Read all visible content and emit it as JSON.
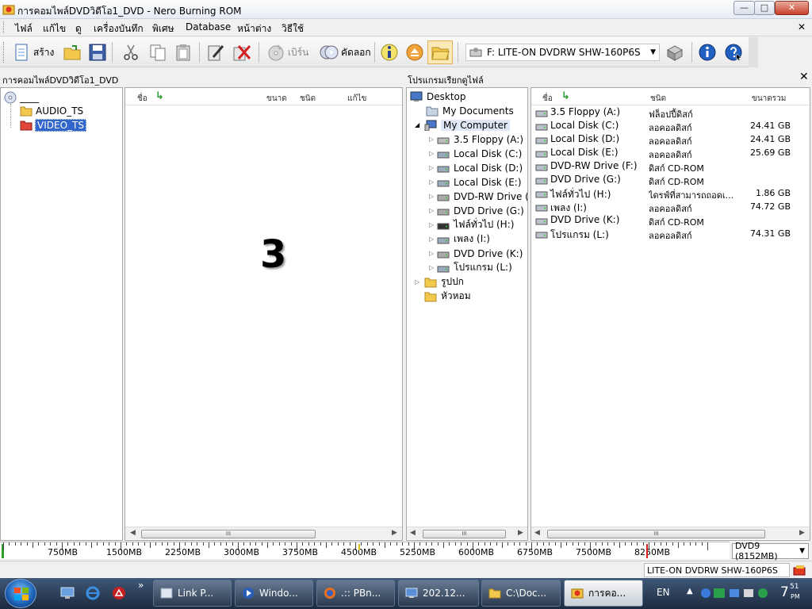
{
  "window": {
    "title": "การคอมไพล์DVDวิดีโอ1_DVD - Nero Burning ROM",
    "min_glyph": "—",
    "max_glyph": "□",
    "close_glyph": "✕"
  },
  "menu": {
    "items": [
      "ไฟล์",
      "แก้ไข",
      "ดู",
      "เครื่องบันทึก",
      "พิเศษ",
      "Database",
      "หน้าต่าง",
      "วิธีใช้"
    ],
    "close_glyph": "✕"
  },
  "toolbar": {
    "new_label": "สร้าง",
    "burn_label": "เบิร์น",
    "copy_label": "คัดลอก",
    "drive": "F: LITE-ON DVDRW SHW-160P6S"
  },
  "compilation": {
    "header": "การคอมไพล์DVDวิดีโอ1_DVD",
    "root_label": "____",
    "folders": [
      "AUDIO_TS",
      "VIDEO_TS"
    ],
    "columns": [
      "ชื่อ",
      "ขนาด",
      "ชนิด",
      "แก้ไข"
    ],
    "big_number": "3",
    "scroll_grip": "III"
  },
  "browser": {
    "header": "โปรแกรมเรียกดูไฟล์",
    "close_glyph": "✕",
    "tree": {
      "desktop": "Desktop",
      "my_documents": "My Documents",
      "my_computer": "My Computer",
      "drives": [
        "3.5 Floppy (A:)",
        "Local Disk (C:)",
        "Local Disk (D:)",
        "Local Disk (E:)",
        "DVD-RW Drive (F",
        "DVD Drive (G:)",
        "ไฟล์ทั่วไป (H:)",
        "เพลง (I:)",
        "DVD Drive (K:)",
        "โปรแกรม (L:)"
      ],
      "folders": [
        "รูปปก",
        "หัวหอม"
      ]
    },
    "list_columns": [
      "ชื่อ",
      "ชนิด",
      "ขนาดรวม"
    ],
    "list": [
      {
        "name": "3.5 Floppy (A:)",
        "type": "ฟล็อปปี้ดิสก์",
        "size": ""
      },
      {
        "name": "Local Disk (C:)",
        "type": "ลอคอลดิสก์",
        "size": "24.41 GB"
      },
      {
        "name": "Local Disk (D:)",
        "type": "ลอคอลดิสก์",
        "size": "24.41 GB"
      },
      {
        "name": "Local Disk (E:)",
        "type": "ลอคอลดิสก์",
        "size": "25.69 GB"
      },
      {
        "name": "DVD-RW Drive (F:)",
        "type": "ดิสก์ CD-ROM",
        "size": ""
      },
      {
        "name": "DVD Drive (G:)",
        "type": "ดิสก์ CD-ROM",
        "size": ""
      },
      {
        "name": "ไฟล์ทั่วไป (H:)",
        "type": "ไดรฟ์ที่สามารถถอดเ...",
        "size": "1.86 GB"
      },
      {
        "name": "เพลง (I:)",
        "type": "ลอคอลดิสก์",
        "size": "74.72 GB"
      },
      {
        "name": "DVD Drive (K:)",
        "type": "ดิสก์ CD-ROM",
        "size": ""
      },
      {
        "name": "โปรแกรม (L:)",
        "type": "ลอคอลดิสก์",
        "size": "74.31 GB"
      }
    ],
    "scroll_grip": "III"
  },
  "capacity": {
    "labels": [
      "750MB",
      "1500MB",
      "2250MB",
      "3000MB",
      "3750MB",
      "4500MB",
      "5250MB",
      "6000MB",
      "6750MB",
      "7500MB",
      "8250MB"
    ],
    "disc_type": "DVD9 (8152MB)"
  },
  "status": {
    "drive": "LITE-ON  DVDRW SHW-160P6S"
  },
  "taskbar": {
    "buttons": [
      "Link P...",
      "Windo...",
      ".:: PBn...",
      "202.12...",
      "C:\\Doc...",
      "การคอ..."
    ],
    "lang": "EN",
    "time": "7",
    "time_min": "51",
    "ampm": "PM"
  }
}
